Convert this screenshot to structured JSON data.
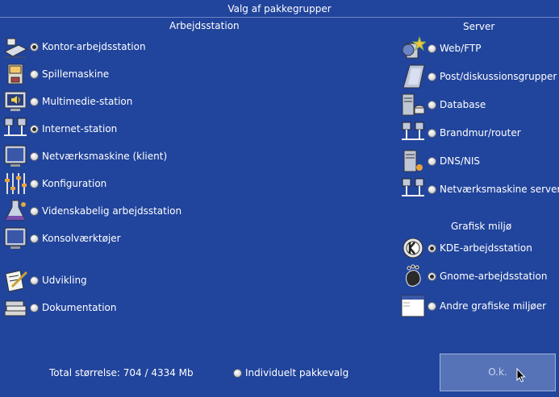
{
  "window_title": "Valg af pakkegrupper",
  "workstation": {
    "heading": "Arbejdsstation",
    "items": [
      {
        "label": "Kontor-arbejdsstation",
        "checked": true,
        "icon": "office-desk-icon"
      },
      {
        "label": "Spillemaskine",
        "checked": false,
        "icon": "pinball-icon"
      },
      {
        "label": "Multimedie-station",
        "checked": false,
        "icon": "speaker-monitor-icon"
      },
      {
        "label": "Internet-station",
        "checked": true,
        "icon": "network-computers-icon"
      },
      {
        "label": "Netværksmaskine (klient)",
        "checked": false,
        "icon": "monitor-icon"
      },
      {
        "label": "Konfiguration",
        "checked": false,
        "icon": "sliders-icon"
      },
      {
        "label": "Videnskabelig arbejdsstation",
        "checked": false,
        "icon": "flask-icon"
      },
      {
        "label": "Konsolværktøjer",
        "checked": false,
        "icon": "terminal-monitor-icon"
      },
      {
        "label": "Udvikling",
        "checked": false,
        "icon": "pen-paper-icon"
      },
      {
        "label": "Dokumentation",
        "checked": false,
        "icon": "books-icon"
      }
    ]
  },
  "server": {
    "heading": "Server",
    "items": [
      {
        "label": "Web/FTP",
        "checked": false,
        "icon": "web-globe-icon"
      },
      {
        "label": "Post/diskussionsgrupper",
        "checked": false,
        "icon": "mail-icon"
      },
      {
        "label": "Database",
        "checked": false,
        "icon": "database-server-icon"
      },
      {
        "label": "Brandmur/router",
        "checked": false,
        "icon": "firewall-network-icon"
      },
      {
        "label": "DNS/NIS",
        "checked": false,
        "icon": "dns-server-icon"
      },
      {
        "label": "Netværksmaskine server",
        "checked": false,
        "icon": "network-server-icon"
      }
    ]
  },
  "graphical": {
    "heading": "Grafisk miljø",
    "items": [
      {
        "label": "KDE-arbejdsstation",
        "checked": true,
        "icon": "kde-gear-icon"
      },
      {
        "label": "Gnome-arbejdsstation",
        "checked": true,
        "icon": "gnome-foot-icon"
      },
      {
        "label": "Andre grafiske miljøer",
        "checked": false,
        "icon": "window-icon"
      }
    ]
  },
  "footer": {
    "total_size": "Total størrelse: 704 / 4334 Mb",
    "individual_label": "Individuelt pakkevalg",
    "individual_checked": false,
    "ok_label": "O.k."
  },
  "colors": {
    "background": "#21449c",
    "button": "#5673b8",
    "text": "#ffffff"
  }
}
